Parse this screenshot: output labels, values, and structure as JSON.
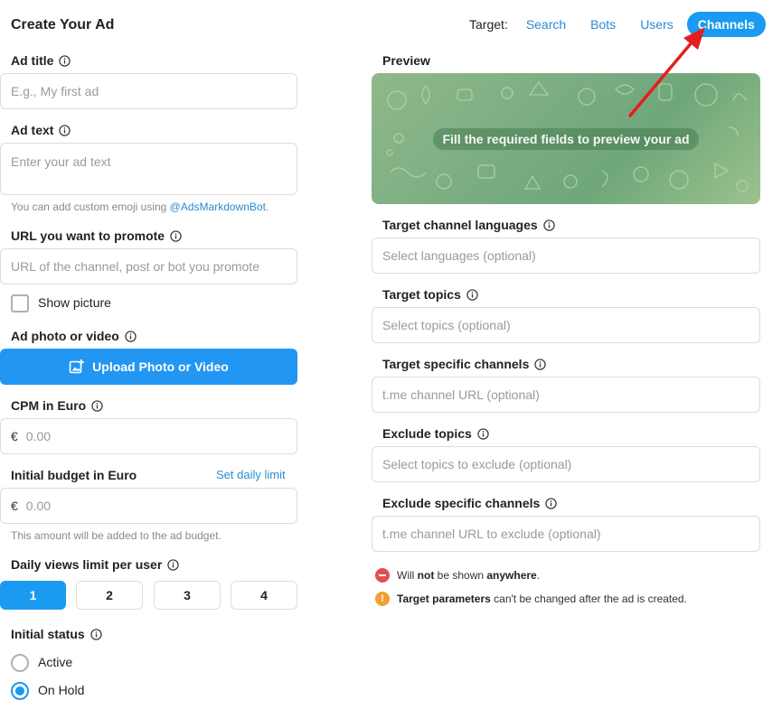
{
  "page_title": "Create Your Ad",
  "target": {
    "label": "Target:",
    "tabs": [
      {
        "label": "Search"
      },
      {
        "label": "Bots"
      },
      {
        "label": "Users"
      },
      {
        "label": "Channels"
      }
    ],
    "active_tab": "Channels"
  },
  "ad_title": {
    "label": "Ad title",
    "placeholder": "E.g., My first ad"
  },
  "ad_text": {
    "label": "Ad text",
    "placeholder": "Enter your ad text",
    "hint_prefix": "You can add custom emoji using ",
    "hint_link": "@AdsMarkdownBot",
    "hint_suffix": "."
  },
  "url": {
    "label": "URL you want to promote",
    "placeholder": "URL of the channel, post or bot you promote"
  },
  "show_picture": {
    "label": "Show picture",
    "checked": false
  },
  "media": {
    "label": "Ad photo or video",
    "button_label": "Upload Photo or Video"
  },
  "cpm": {
    "label": "CPM in Euro",
    "currency": "€",
    "placeholder": "0.00"
  },
  "budget": {
    "label": "Initial budget in Euro",
    "link": "Set daily limit",
    "currency": "€",
    "placeholder": "0.00",
    "hint": "This amount will be added to the ad budget."
  },
  "daily_views": {
    "label": "Daily views limit per user",
    "options": [
      "1",
      "2",
      "3",
      "4"
    ],
    "selected": "1"
  },
  "initial_status": {
    "label": "Initial status",
    "options": [
      {
        "label": "Active",
        "checked": false
      },
      {
        "label": "On Hold",
        "checked": true
      }
    ]
  },
  "preview": {
    "label": "Preview",
    "message": "Fill the required fields to preview your ad"
  },
  "target_languages": {
    "label": "Target channel languages",
    "placeholder": "Select languages (optional)"
  },
  "target_topics": {
    "label": "Target topics",
    "placeholder": "Select topics (optional)"
  },
  "target_channels": {
    "label": "Target specific channels",
    "placeholder": "t.me channel URL (optional)"
  },
  "exclude_topics": {
    "label": "Exclude topics",
    "placeholder": "Select topics to exclude (optional)"
  },
  "exclude_channels": {
    "label": "Exclude specific channels",
    "placeholder": "t.me channel URL to exclude (optional)"
  },
  "notes": {
    "first": {
      "a": "Will ",
      "b": "not",
      "c": " be shown ",
      "d": "anywhere",
      "e": "."
    },
    "second": {
      "a": "Target parameters",
      "b": " can't be changed after the ad is created."
    }
  },
  "colors": {
    "accent": "#1a9af0",
    "upload_button": "#2196f3",
    "link": "#2a8bd0",
    "warning": "#f0a030",
    "danger": "#e05050",
    "annotation_arrow": "#e41e1e"
  },
  "icons": [
    "info-icon",
    "add-photo-icon",
    "no-entry-icon",
    "warning-icon",
    "red-arrow-annotation"
  ]
}
